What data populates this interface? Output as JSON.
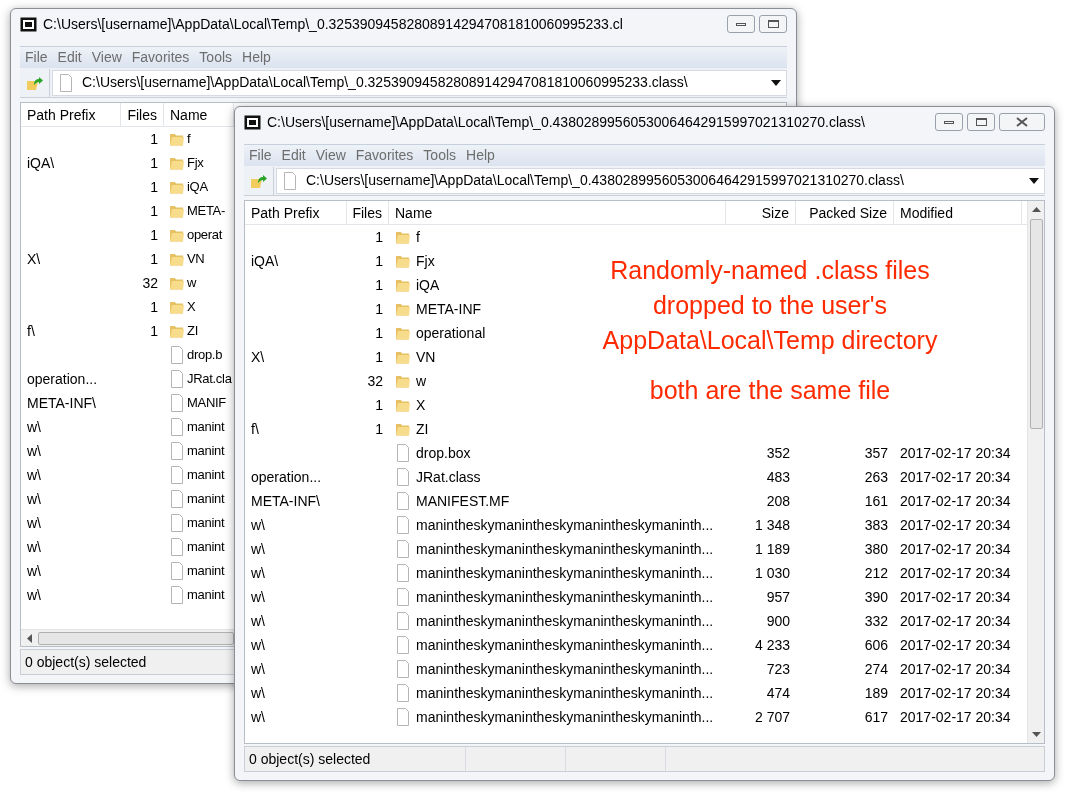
{
  "windows": [
    {
      "title": "C:\\Users\\[username]\\AppData\\Local\\Temp\\_0.325390945828089142947081810060995233.cl",
      "menu": [
        "File",
        "Edit",
        "View",
        "Favorites",
        "Tools",
        "Help"
      ],
      "address": "C:\\Users\\[username]\\AppData\\Local\\Temp\\_0.325390945828089142947081810060995233.class\\",
      "columns": [
        "Path Prefix",
        "Files",
        "Name"
      ],
      "rows": [
        {
          "kind": "folder",
          "files": "1",
          "name": "f"
        },
        {
          "kind": "folder",
          "path_prefix": "iQA\\",
          "files": "1",
          "name": "Fjx"
        },
        {
          "kind": "folder",
          "files": "1",
          "name": "iQA"
        },
        {
          "kind": "folder",
          "files": "1",
          "name": "META-"
        },
        {
          "kind": "folder",
          "files": "1",
          "name": "operat"
        },
        {
          "kind": "folder",
          "path_prefix": "X\\",
          "files": "1",
          "name": "VN"
        },
        {
          "kind": "folder",
          "files": "32",
          "name": "w"
        },
        {
          "kind": "folder",
          "files": "1",
          "name": "X"
        },
        {
          "kind": "folder",
          "path_prefix": "f\\",
          "files": "1",
          "name": "ZI"
        },
        {
          "kind": "file",
          "name": "drop.b"
        },
        {
          "kind": "file",
          "path_prefix": "operation...",
          "name": "JRat.cla"
        },
        {
          "kind": "file",
          "path_prefix": "META-INF\\",
          "name": "MANIF"
        },
        {
          "kind": "file",
          "path_prefix": "w\\",
          "name": "manint"
        },
        {
          "kind": "file",
          "path_prefix": "w\\",
          "name": "manint"
        },
        {
          "kind": "file",
          "path_prefix": "w\\",
          "name": "manint"
        },
        {
          "kind": "file",
          "path_prefix": "w\\",
          "name": "manint"
        },
        {
          "kind": "file",
          "path_prefix": "w\\",
          "name": "manint"
        },
        {
          "kind": "file",
          "path_prefix": "w\\",
          "name": "manint"
        },
        {
          "kind": "file",
          "path_prefix": "w\\",
          "name": "manint"
        },
        {
          "kind": "file",
          "path_prefix": "w\\",
          "name": "manint"
        }
      ],
      "status": "0 object(s) selected"
    },
    {
      "title": "C:\\Users\\[username]\\AppData\\Local\\Temp\\_0.43802899560530064642915997021310270.class\\",
      "menu": [
        "File",
        "Edit",
        "View",
        "Favorites",
        "Tools",
        "Help"
      ],
      "address": "C:\\Users\\[username]\\AppData\\Local\\Temp\\_0.43802899560530064642915997021310270.class\\",
      "columns": [
        "Path Prefix",
        "Files",
        "Name",
        "Size",
        "Packed Size",
        "Modified"
      ],
      "rows": [
        {
          "kind": "folder",
          "files": "1",
          "name": "f"
        },
        {
          "kind": "folder",
          "path_prefix": "iQA\\",
          "files": "1",
          "name": "Fjx"
        },
        {
          "kind": "folder",
          "files": "1",
          "name": "iQA"
        },
        {
          "kind": "folder",
          "files": "1",
          "name": "META-INF"
        },
        {
          "kind": "folder",
          "files": "1",
          "name": "operational"
        },
        {
          "kind": "folder",
          "path_prefix": "X\\",
          "files": "1",
          "name": "VN"
        },
        {
          "kind": "folder",
          "files": "32",
          "name": "w"
        },
        {
          "kind": "folder",
          "files": "1",
          "name": "X"
        },
        {
          "kind": "folder",
          "path_prefix": "f\\",
          "files": "1",
          "name": "ZI"
        },
        {
          "kind": "file",
          "name": "drop.box",
          "size": "352",
          "packed_size": "357",
          "modified": "2017-02-17 20:34"
        },
        {
          "kind": "file",
          "path_prefix": "operation...",
          "name": "JRat.class",
          "size": "483",
          "packed_size": "263",
          "modified": "2017-02-17 20:34"
        },
        {
          "kind": "file",
          "path_prefix": "META-INF\\",
          "name": "MANIFEST.MF",
          "size": "208",
          "packed_size": "161",
          "modified": "2017-02-17 20:34"
        },
        {
          "kind": "file",
          "path_prefix": "w\\",
          "name": "manintheskymanintheskymanintheskymaninth...",
          "size": "1 348",
          "packed_size": "383",
          "modified": "2017-02-17 20:34"
        },
        {
          "kind": "file",
          "path_prefix": "w\\",
          "name": "manintheskymanintheskymanintheskymaninth...",
          "size": "1 189",
          "packed_size": "380",
          "modified": "2017-02-17 20:34"
        },
        {
          "kind": "file",
          "path_prefix": "w\\",
          "name": "manintheskymanintheskymanintheskymaninth...",
          "size": "1 030",
          "packed_size": "212",
          "modified": "2017-02-17 20:34"
        },
        {
          "kind": "file",
          "path_prefix": "w\\",
          "name": "manintheskymanintheskymanintheskymaninth...",
          "size": "957",
          "packed_size": "390",
          "modified": "2017-02-17 20:34"
        },
        {
          "kind": "file",
          "path_prefix": "w\\",
          "name": "manintheskymanintheskymanintheskymaninth...",
          "size": "900",
          "packed_size": "332",
          "modified": "2017-02-17 20:34"
        },
        {
          "kind": "file",
          "path_prefix": "w\\",
          "name": "manintheskymanintheskymanintheskymaninth...",
          "size": "4 233",
          "packed_size": "606",
          "modified": "2017-02-17 20:34"
        },
        {
          "kind": "file",
          "path_prefix": "w\\",
          "name": "manintheskymanintheskymanintheskymaninth...",
          "size": "723",
          "packed_size": "274",
          "modified": "2017-02-17 20:34"
        },
        {
          "kind": "file",
          "path_prefix": "w\\",
          "name": "manintheskymanintheskymanintheskymaninth...",
          "size": "474",
          "packed_size": "189",
          "modified": "2017-02-17 20:34"
        },
        {
          "kind": "file",
          "path_prefix": "w\\",
          "name": "manintheskymanintheskymanintheskymaninth...",
          "size": "2 707",
          "packed_size": "617",
          "modified": "2017-02-17 20:34"
        }
      ],
      "status": "0 object(s) selected"
    }
  ],
  "annotation": {
    "lines": [
      "Randomly-named .class files",
      "dropped to the user's",
      "AppData\\Local\\Temp directory"
    ],
    "note": "both are the same file"
  }
}
